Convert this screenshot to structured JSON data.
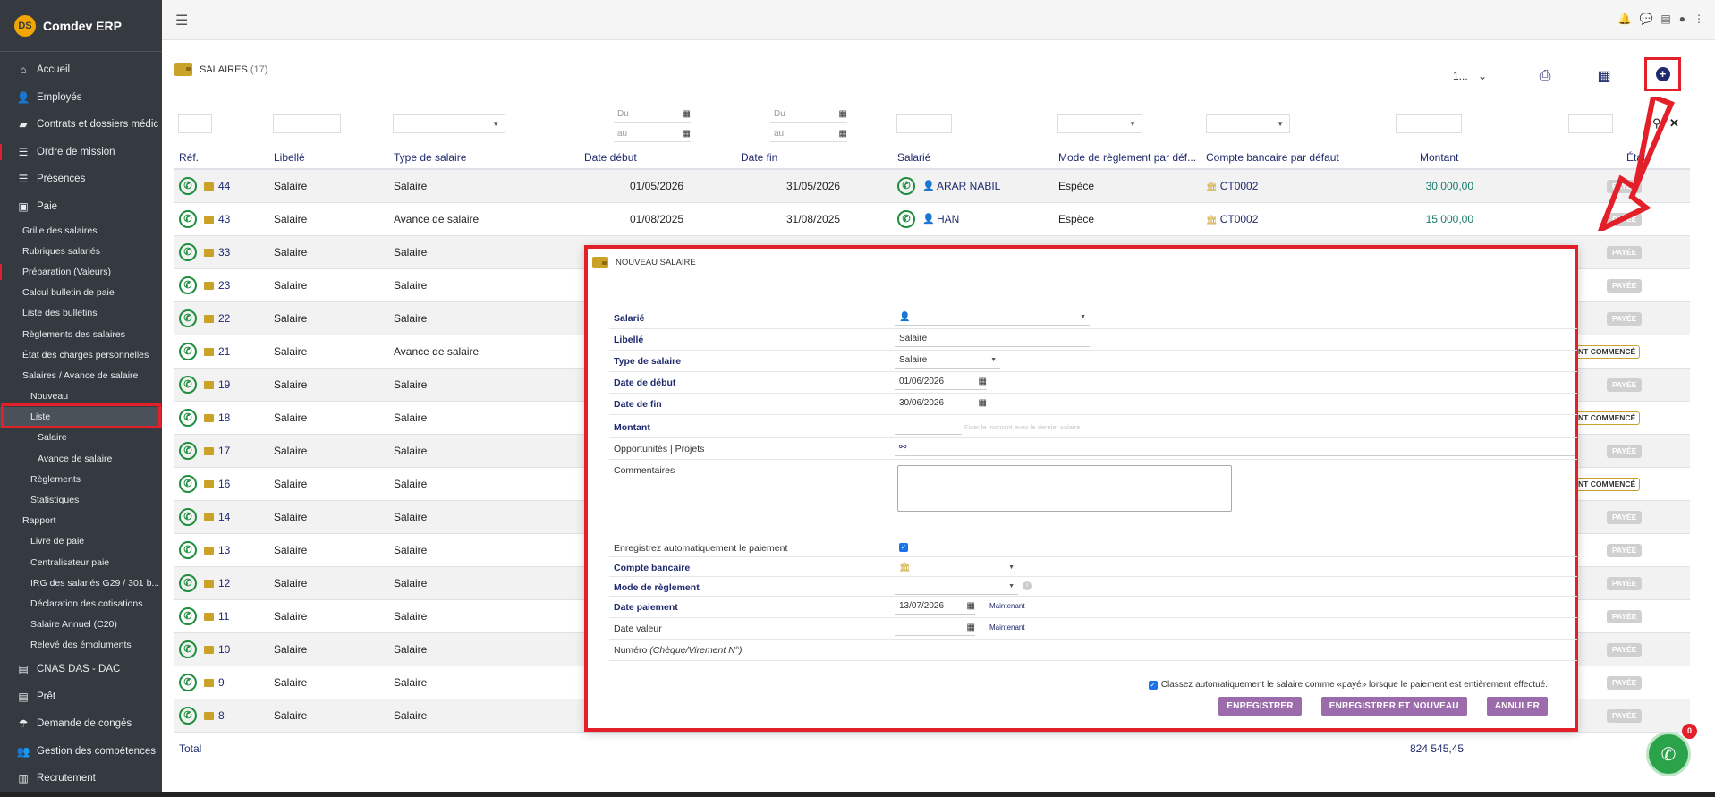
{
  "sidebar": {
    "brand": "Comdev ERP",
    "brand_logo": "DS",
    "items": [
      {
        "label": "Accueil",
        "icon": "home-icon",
        "glyph": "⌂"
      },
      {
        "label": "Employés",
        "icon": "user-icon",
        "glyph": "👤"
      },
      {
        "label": "Contrats et dossiers médic",
        "icon": "folder-icon",
        "glyph": "▰"
      },
      {
        "label": "Ordre de mission",
        "icon": "list-icon",
        "glyph": "☰"
      },
      {
        "label": "Présences",
        "icon": "list-icon",
        "glyph": "☰"
      },
      {
        "label": "Paie",
        "icon": "wallet-icon",
        "glyph": "▣"
      }
    ],
    "paie_sub": [
      {
        "label": "Grille des salaires",
        "level": 1
      },
      {
        "label": "Rubriques salariés",
        "level": 1
      },
      {
        "label": "Préparation (Valeurs)",
        "level": 1
      },
      {
        "label": "Calcul bulletin de paie",
        "level": 1
      },
      {
        "label": "Liste des bulletins",
        "level": 1
      },
      {
        "label": "Règlements des salaires",
        "level": 1
      },
      {
        "label": "État des charges personnelles",
        "level": 1
      },
      {
        "label": "Salaires / Avance de salaire",
        "level": 1
      },
      {
        "label": "Nouveau",
        "level": 2
      },
      {
        "label": "Liste",
        "level": 2,
        "active": true
      },
      {
        "label": "Salaire",
        "level": 3
      },
      {
        "label": "Avance de salaire",
        "level": 3
      },
      {
        "label": "Règlements",
        "level": 2
      },
      {
        "label": "Statistiques",
        "level": 2
      },
      {
        "label": "Rapport",
        "level": 1
      },
      {
        "label": "Livre de paie",
        "level": 2
      },
      {
        "label": "Centralisateur paie",
        "level": 2
      },
      {
        "label": "IRG des salariés G29 / 301 b...",
        "level": 2
      },
      {
        "label": "Déclaration des cotisations",
        "level": 2
      },
      {
        "label": "Salaire Annuel (C20)",
        "level": 2
      },
      {
        "label": "Relevé des émoluments",
        "level": 2
      }
    ],
    "bottom_items": [
      {
        "label": "CNAS DAS - DAC",
        "icon": "doc-icon",
        "glyph": "▤"
      },
      {
        "label": "Prêt",
        "icon": "doc-icon",
        "glyph": "▤"
      },
      {
        "label": "Demande de congés",
        "icon": "beach-icon",
        "glyph": "☂"
      },
      {
        "label": "Gestion des compétences",
        "icon": "users-icon",
        "glyph": "👥"
      },
      {
        "label": "Recrutement",
        "icon": "badge-icon",
        "glyph": "▥"
      }
    ]
  },
  "header": {
    "title": "SALAIRES",
    "count": "(17)",
    "per_page": "1..."
  },
  "filters": {
    "du": "Du",
    "au": "au"
  },
  "table": {
    "columns": [
      "Réf.",
      "Libellé",
      "Type de salaire",
      "Date début",
      "Date fin",
      "Salarié",
      "Mode de règlement par déf...",
      "Compte bancaire par défaut",
      "Montant",
      "État"
    ],
    "rows": [
      {
        "ref": "44",
        "libelle": "Salaire",
        "type": "Salaire",
        "debut": "01/05/2026",
        "fin": "31/05/2026",
        "salarie": "ARAR NABIL",
        "mode": "Espèce",
        "compte": "CT0002",
        "montant": "30 000,00",
        "etat": "PAYÉE",
        "etat_kind": "paid"
      },
      {
        "ref": "43",
        "libelle": "Salaire",
        "type": "Avance de salaire",
        "debut": "01/08/2025",
        "fin": "31/08/2025",
        "salarie": "HAN",
        "mode": "Espèce",
        "compte": "CT0002",
        "montant": "15 000,00",
        "etat": "PAYÉE",
        "etat_kind": "paid"
      },
      {
        "ref": "33",
        "libelle": "Salaire",
        "type": "Salaire",
        "etat": "PAYÉE",
        "etat_kind": "paid"
      },
      {
        "ref": "23",
        "libelle": "Salaire",
        "type": "Salaire",
        "etat": "PAYÉE",
        "etat_kind": "paid"
      },
      {
        "ref": "22",
        "libelle": "Salaire",
        "type": "Salaire",
        "etat": "PAYÉE",
        "etat_kind": "paid"
      },
      {
        "ref": "21",
        "libelle": "Salaire",
        "type": "Avance de salaire",
        "etat": "NT COMMENCÉ",
        "etat_kind": "started"
      },
      {
        "ref": "19",
        "libelle": "Salaire",
        "type": "Salaire",
        "etat": "PAYÉE",
        "etat_kind": "paid"
      },
      {
        "ref": "18",
        "libelle": "Salaire",
        "type": "Salaire",
        "etat": "NT COMMENCÉ",
        "etat_kind": "started"
      },
      {
        "ref": "17",
        "libelle": "Salaire",
        "type": "Salaire",
        "etat": "PAYÉE",
        "etat_kind": "paid"
      },
      {
        "ref": "16",
        "libelle": "Salaire",
        "type": "Salaire",
        "etat": "NT COMMENCÉ",
        "etat_kind": "started"
      },
      {
        "ref": "14",
        "libelle": "Salaire",
        "type": "Salaire",
        "etat": "PAYÉE",
        "etat_kind": "paid"
      },
      {
        "ref": "13",
        "libelle": "Salaire",
        "type": "Salaire",
        "etat": "PAYÉE",
        "etat_kind": "paid"
      },
      {
        "ref": "12",
        "libelle": "Salaire",
        "type": "Salaire",
        "etat": "PAYÉE",
        "etat_kind": "paid"
      },
      {
        "ref": "11",
        "libelle": "Salaire",
        "type": "Salaire",
        "etat": "PAYÉE",
        "etat_kind": "paid"
      },
      {
        "ref": "10",
        "libelle": "Salaire",
        "type": "Salaire",
        "etat": "PAYÉE",
        "etat_kind": "paid"
      },
      {
        "ref": "9",
        "libelle": "Salaire",
        "type": "Salaire",
        "etat": "PAYÉE",
        "etat_kind": "paid"
      },
      {
        "ref": "8",
        "libelle": "Salaire",
        "type": "Salaire",
        "etat": "PAYÉE",
        "etat_kind": "paid"
      }
    ],
    "total_label": "Total",
    "total_value": "824 545,45"
  },
  "modal": {
    "title": "NOUVEAU SALAIRE",
    "labels": {
      "salarie": "Salarié",
      "libelle": "Libellé",
      "type": "Type de salaire",
      "debut": "Date de début",
      "fin": "Date de fin",
      "montant": "Montant",
      "opportunites": "Opportunités | Projets",
      "commentaires": "Commentaires",
      "auto_paiement": "Enregistrez automatiquement le paiement",
      "compte": "Compte bancaire",
      "mode": "Mode de règlement",
      "date_paiement": "Date paiement",
      "date_valeur": "Date valeur",
      "numero": "Numéro",
      "numero_hint": "(Chèque/Virement N°)"
    },
    "values": {
      "libelle": "Salaire",
      "type": "Salaire",
      "debut": "01/06/2026",
      "fin": "30/06/2026",
      "montant_hint": "Fixer le montant avec le dernier salaire",
      "date_paiement": "13/07/2026"
    },
    "now_label": "Maintenant",
    "auto_classify": "Classez automatiquement le salaire comme «payé» lorsque le paiement est entièrement effectué.",
    "buttons": {
      "save": "ENREGISTRER",
      "save_new": "ENREGISTRER ET NOUVEAU",
      "cancel": "ANNULER"
    }
  },
  "chat": {
    "badge": "0"
  },
  "colors": {
    "accent": "#1f2a6e",
    "highlight": "#e3202a",
    "button": "#9b6bab",
    "amount": "#177a6a"
  }
}
